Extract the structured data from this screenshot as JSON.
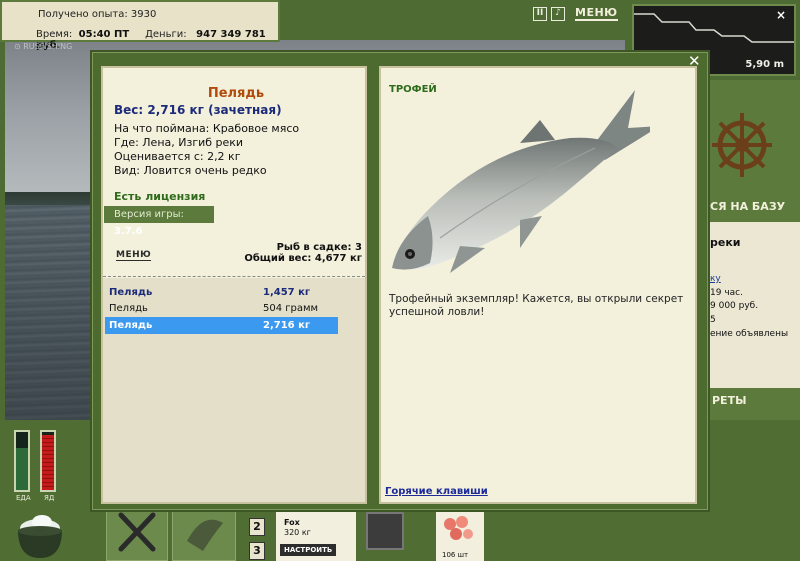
{
  "hud": {
    "experience_label": "Получено опыта:",
    "experience_value": "3930",
    "time_label": "Время:",
    "time_value": "05:40 ПТ",
    "money_label": "Деньги:",
    "money_value": "947 349 781 руб.",
    "menu_label": "МЕНЮ",
    "depth_value": "5,90 m"
  },
  "background_panel": {
    "base_label": "СЯ НА БАЗУ",
    "location_fragment": "реки",
    "link_fragment": "ку",
    "line1": "19 час.",
    "line2": "9 000 руб.",
    "line3": "5",
    "line4": "ение объявлены",
    "secrets_label": "РЕТЫ"
  },
  "bottom_bar": {
    "food_label": "ЕДА",
    "poison_label": "ЯД",
    "food_level": 0.72,
    "poison_level": 0.95,
    "slot2": "2",
    "slot3": "3",
    "tackle_name": "Fox",
    "tackle_weight": "320 кг",
    "configure_label": "НАСТРОИТЬ",
    "bait_count": "106 шт"
  },
  "fish_card": {
    "name": "Пелядь",
    "weight": "Вес: 2,716 кг (зачетная)",
    "bait": "На что поймана: Крабовое мясо",
    "location": "Где: Лена, Изгиб реки",
    "estimate": "Оценивается с: 2,2 кг",
    "kind": "Вид: Ловится очень редко",
    "license": "Есть лицензия",
    "version_label": "Версия игры:",
    "version_value": "3.7.6",
    "menu_label": "МЕНЮ",
    "cage_count": "Рыб в садке: 3",
    "cage_weight": "Общий вес: 4,677 кг"
  },
  "catch_list": [
    {
      "name": "Пелядь",
      "weight": "1,457 кг"
    },
    {
      "name": "Пелядь",
      "weight": "504 грамм"
    },
    {
      "name": "Пелядь",
      "weight": "2,716 кг"
    }
  ],
  "trophy": {
    "label": "ТРОФЕЙ",
    "text": "Трофейный экземпляр! Кажется, вы открыли секрет успешной ловли!",
    "hotkeys": "Горячие клавиши"
  },
  "colors": {
    "frame_green": "#4d6a2f",
    "panel_cream": "#f3f0dc",
    "fish_name": "#b24a0c",
    "weight_blue": "#1c2a7a",
    "license_green": "#2e6b1a",
    "selected_row": "#3b99f0"
  }
}
